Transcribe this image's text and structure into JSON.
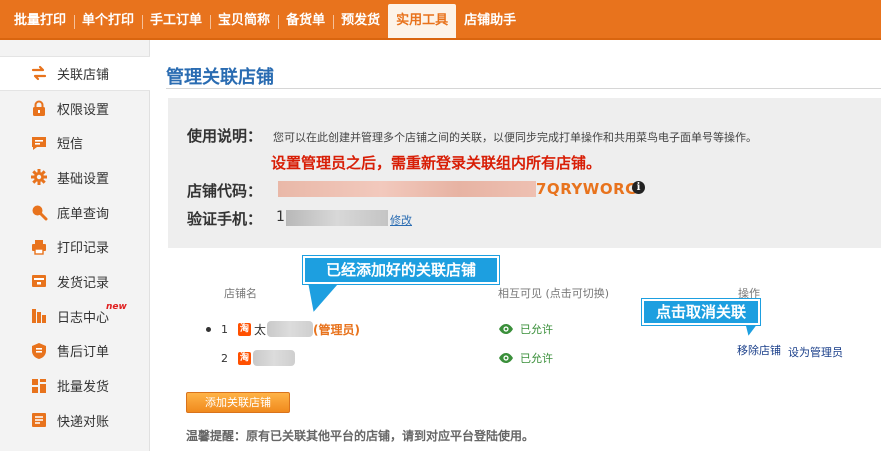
{
  "top_nav": {
    "tabs": [
      {
        "label": "批量打印"
      },
      {
        "label": "单个打印"
      },
      {
        "label": "手工订单"
      },
      {
        "label": "宝贝简称"
      },
      {
        "label": "备货单"
      },
      {
        "label": "预发货"
      },
      {
        "label": "实用工具",
        "active": true
      },
      {
        "label": "店铺助手"
      }
    ]
  },
  "sidebar": {
    "items": [
      {
        "label": "关联店铺",
        "icon": "swap-arrows-icon",
        "active": true
      },
      {
        "label": "权限设置",
        "icon": "lock-icon"
      },
      {
        "label": "短信",
        "icon": "message-icon"
      },
      {
        "label": "基础设置",
        "icon": "gear-icon"
      },
      {
        "label": "底单查询",
        "icon": "search-icon"
      },
      {
        "label": "打印记录",
        "icon": "printer-icon"
      },
      {
        "label": "发货记录",
        "icon": "box-icon"
      },
      {
        "label": "日志中心",
        "icon": "log-icon",
        "badge": "new"
      },
      {
        "label": "售后订单",
        "icon": "shield-icon"
      },
      {
        "label": "批量发货",
        "icon": "grid-icon"
      },
      {
        "label": "快递对账",
        "icon": "reconcile-icon"
      }
    ]
  },
  "main": {
    "title": "管理关联店铺",
    "info": {
      "usage_label": "使用说明：",
      "usage_text": "您可以在此创建并管理多个店铺之间的关联，以便同步完成打单操作和共用菜鸟电子面单号等操作。",
      "warning": "设置管理员之后，需重新登录关联组内所有店铺。",
      "shop_code_label": "店铺代码：",
      "shop_code_visible": "7QRYWORG",
      "phone_label": "验证手机：",
      "phone_prefix": "1",
      "modify_link": "修改"
    },
    "table": {
      "headers": {
        "shop_name": "店铺名",
        "mutual_visible": "相互可见 (点击可切换)",
        "action": "操作"
      },
      "rows": [
        {
          "index": "1",
          "platform_icon": "淘",
          "shop_name_prefix": "太",
          "admin_tag": "(管理员)",
          "permission": "已允许"
        },
        {
          "index": "2",
          "platform_icon": "淘",
          "shop_name_prefix": "",
          "admin_tag": "",
          "permission": "已允许"
        }
      ],
      "actions": {
        "remove": "移除店铺",
        "set_admin": "设为管理员"
      }
    },
    "add_button": "添加关联店铺",
    "tip": "温馨提醒：原有已关联其他平台的店铺，请到对应平台登陆使用。"
  },
  "annotations": {
    "added_shops": "已经添加好的关联店铺",
    "click_to_remove": "点击取消关联"
  },
  "colors": {
    "nav_orange": "#e8731d",
    "title_blue": "#2a6cb2",
    "warning_red": "#d81e06",
    "callout_blue": "#1d9fe0",
    "allowed_green": "#3a8f3a"
  }
}
